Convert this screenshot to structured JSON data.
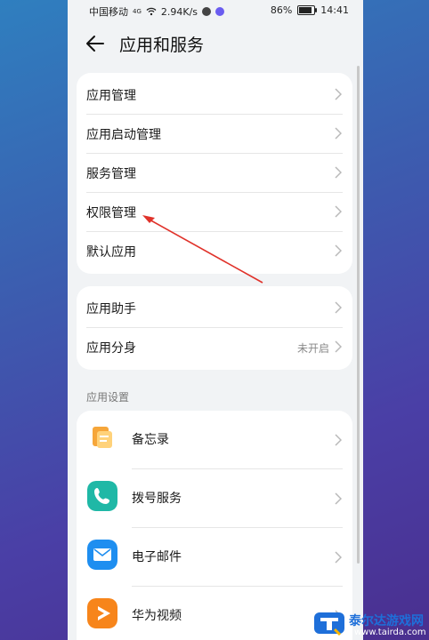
{
  "status_bar": {
    "carrier": "中国移动",
    "signal": "4G",
    "speed": "2.94K/s",
    "battery": "86%",
    "battery_level": 0.86,
    "time": "14:41"
  },
  "appbar": {
    "title": "应用和服务",
    "back_icon": "arrow-left-icon"
  },
  "group1": {
    "items": [
      {
        "label": "应用管理"
      },
      {
        "label": "应用启动管理"
      },
      {
        "label": "服务管理"
      },
      {
        "label": "权限管理"
      },
      {
        "label": "默认应用"
      }
    ]
  },
  "group2": {
    "items": [
      {
        "label": "应用助手",
        "value": ""
      },
      {
        "label": "应用分身",
        "value": "未开启"
      }
    ]
  },
  "app_settings": {
    "section_label": "应用设置",
    "items": [
      {
        "label": "备忘录",
        "icon": "memo-icon",
        "color": "#f39a1e"
      },
      {
        "label": "拨号服务",
        "icon": "phone-icon",
        "color": "#1fb8a6"
      },
      {
        "label": "电子邮件",
        "icon": "mail-icon",
        "color": "#1e8ef0"
      },
      {
        "label": "华为视频",
        "icon": "video-icon",
        "color": "#f7851b"
      }
    ]
  },
  "watermark": {
    "name": "泰尔达游戏网",
    "url": "www.tairda.com"
  },
  "colors": {
    "accent_arrow": "#e0322a",
    "background": "#f1f3f5"
  }
}
